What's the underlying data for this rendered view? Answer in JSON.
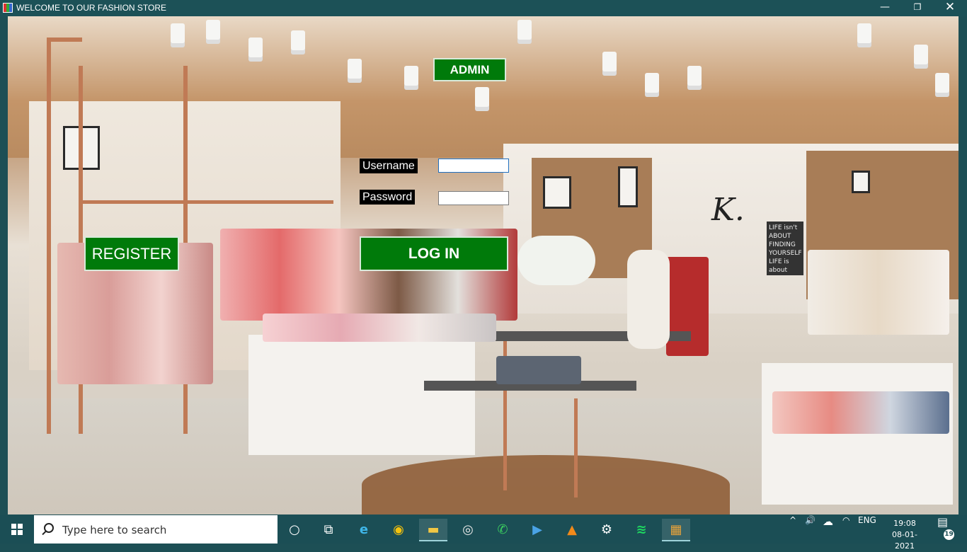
{
  "window": {
    "title": "WELCOME TO OUR FASHION STORE",
    "minimize_label": "—",
    "maximize_label": "❐",
    "close_label": "✕"
  },
  "scene": {
    "logo_letter": "K.",
    "sign_text": "LIFE isn't ABOUT FINDING YOURSELF LIFE is about CREATING YOURSELF"
  },
  "form": {
    "admin_label": "ADMIN",
    "username_label": "Username",
    "username_value": "",
    "password_label": "Password",
    "password_value": "",
    "register_label": "REGISTER",
    "login_label": "LOG IN"
  },
  "taskbar": {
    "search_placeholder": "Type here to search",
    "apps": [
      {
        "icon": "cortana-icon",
        "glyph": "○"
      },
      {
        "icon": "task-view-icon",
        "glyph": "⧉"
      },
      {
        "icon": "edge-icon",
        "glyph": "e"
      },
      {
        "icon": "chrome-icon",
        "glyph": "◉"
      },
      {
        "icon": "file-explorer-icon",
        "glyph": "▬"
      },
      {
        "icon": "media-player-icon",
        "glyph": "◎"
      },
      {
        "icon": "whatsapp-icon",
        "glyph": "✆"
      },
      {
        "icon": "video-editor-icon",
        "glyph": "▶"
      },
      {
        "icon": "vlc-icon",
        "glyph": "▲"
      },
      {
        "icon": "settings-icon",
        "glyph": "⚙"
      },
      {
        "icon": "spotify-icon",
        "glyph": "≋"
      },
      {
        "icon": "fashion-store-app-icon",
        "glyph": "▦"
      }
    ],
    "tray": {
      "chevron": "^",
      "volume": "🔊",
      "cloud": "☁",
      "wifi": "◠",
      "language": "ENG",
      "time": "19:08",
      "date": "08-01-2021",
      "notifications_count": "19"
    }
  },
  "colors": {
    "button_green": "#007a0a",
    "titlebar": "#1c5157",
    "taskbar": "#1b4e55"
  }
}
